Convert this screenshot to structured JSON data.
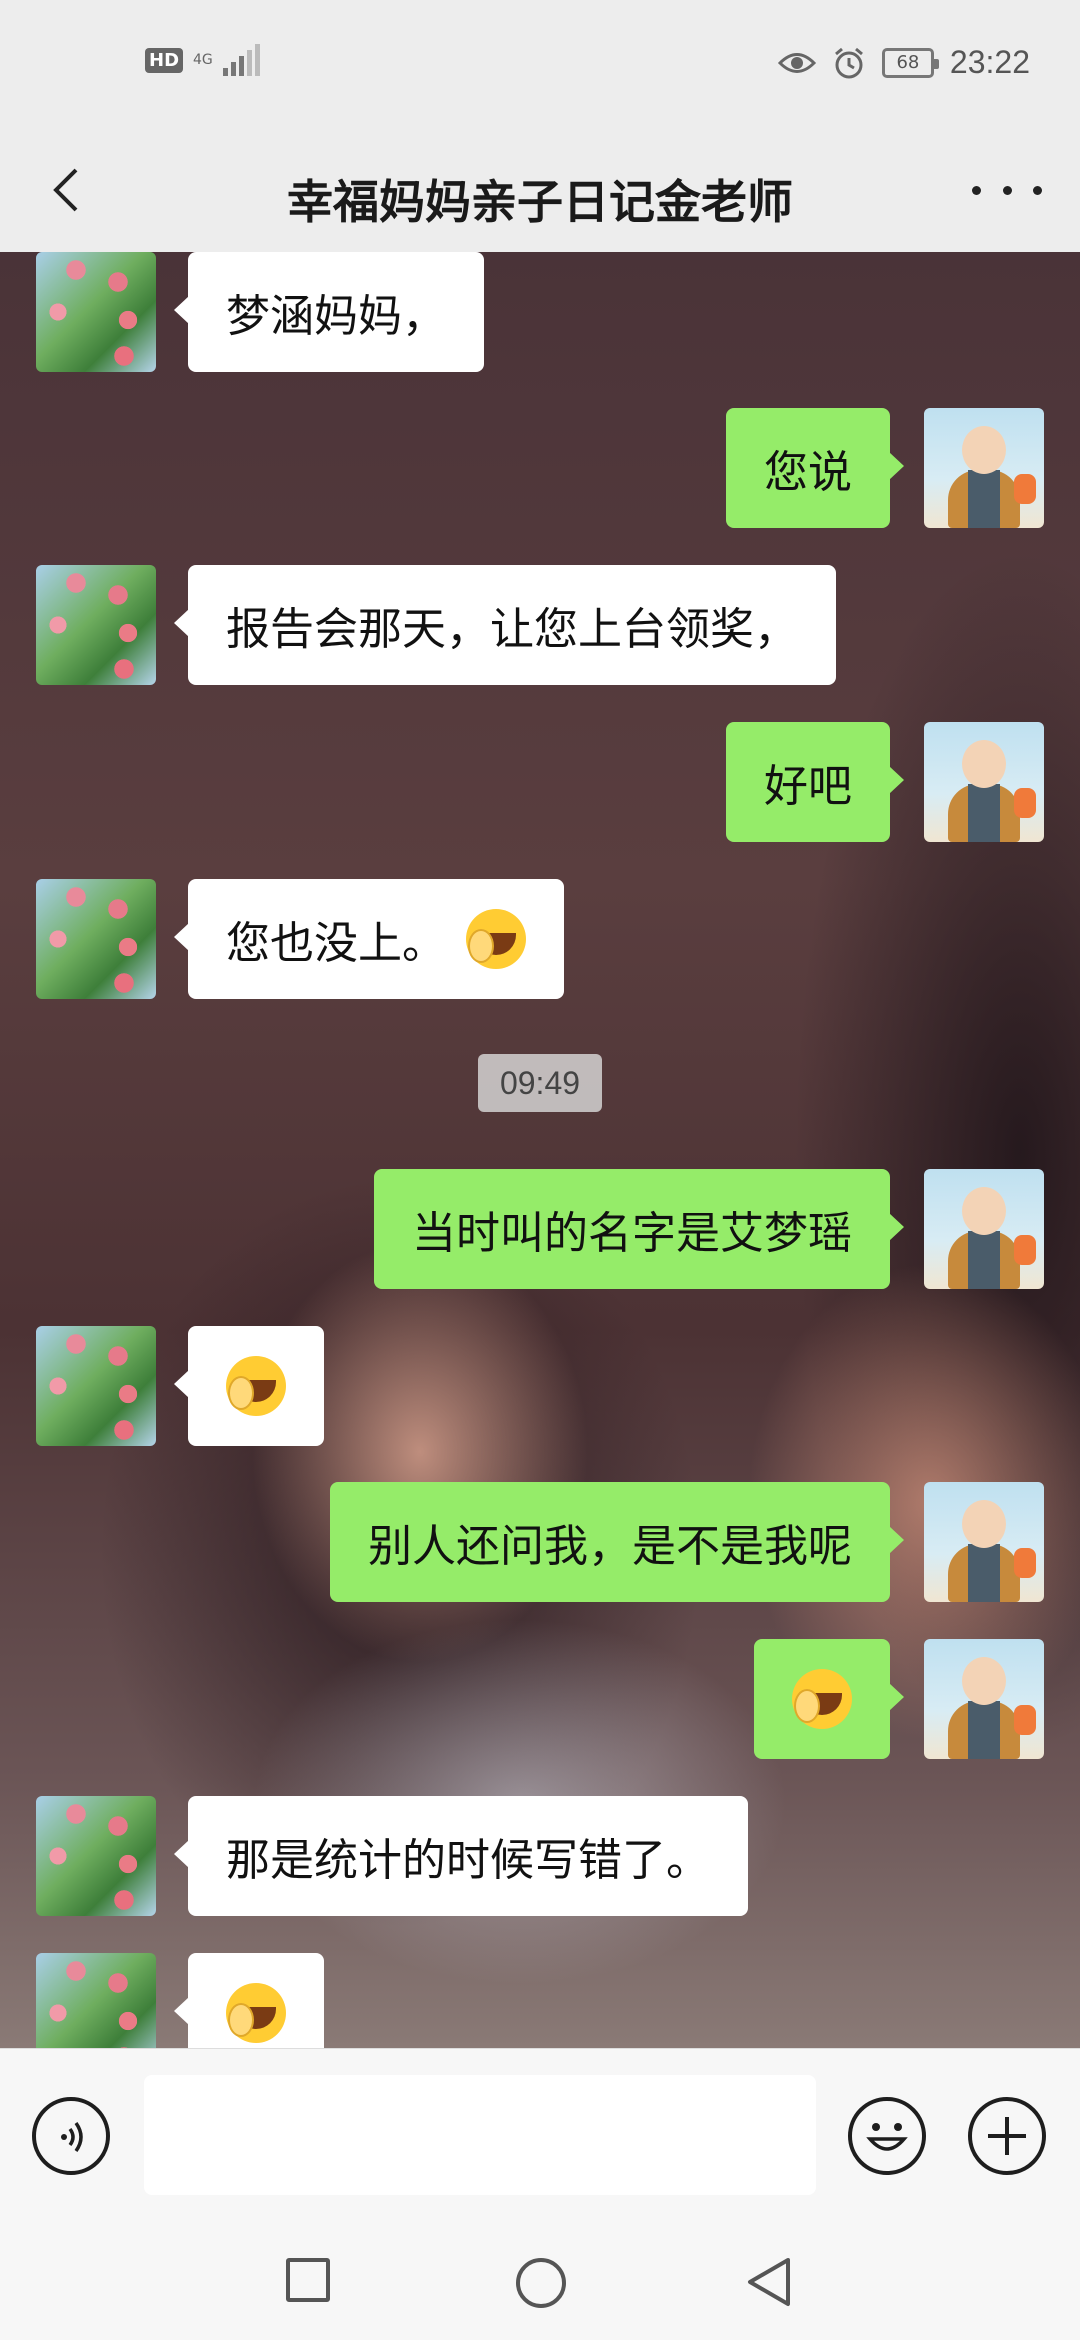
{
  "status_bar": {
    "hd": "HD",
    "network": "4G",
    "battery": "68",
    "time": "23:22",
    "icons": [
      "eye-icon",
      "alarm-icon"
    ]
  },
  "header": {
    "title": "幸福妈妈亲子日记金老师",
    "back_icon": "chevron-left-icon",
    "more_icon": "more-dots-icon"
  },
  "messages": [
    {
      "side": "in",
      "text": "梦涵妈妈，"
    },
    {
      "side": "out",
      "text": "您说"
    },
    {
      "side": "in",
      "text": "报告会那天，让您上台领奖，"
    },
    {
      "side": "out",
      "text": "好吧"
    },
    {
      "side": "in",
      "text": "您也没上。",
      "emoji": "facepalm-emoji"
    },
    {
      "side": "out",
      "text": "当时叫的名字是艾梦瑶"
    },
    {
      "side": "in",
      "emoji": "facepalm-emoji"
    },
    {
      "side": "out",
      "text": "别人还问我，是不是我呢"
    },
    {
      "side": "out",
      "emoji": "facepalm-emoji"
    },
    {
      "side": "in",
      "text": "那是统计的时候写错了。"
    },
    {
      "side": "in",
      "emoji": "facepalm-emoji"
    }
  ],
  "timestamp": "09:49",
  "input_bar": {
    "voice_icon": "voice-icon",
    "emoji_icon": "emoji-icon",
    "plus_icon": "plus-icon"
  },
  "nav": {
    "icons": [
      "recent-apps-icon",
      "home-icon",
      "back-icon"
    ]
  },
  "colors": {
    "incoming_bubble": "#ffffff",
    "outgoing_bubble": "#95ec69",
    "bar_background": "#ededed"
  }
}
